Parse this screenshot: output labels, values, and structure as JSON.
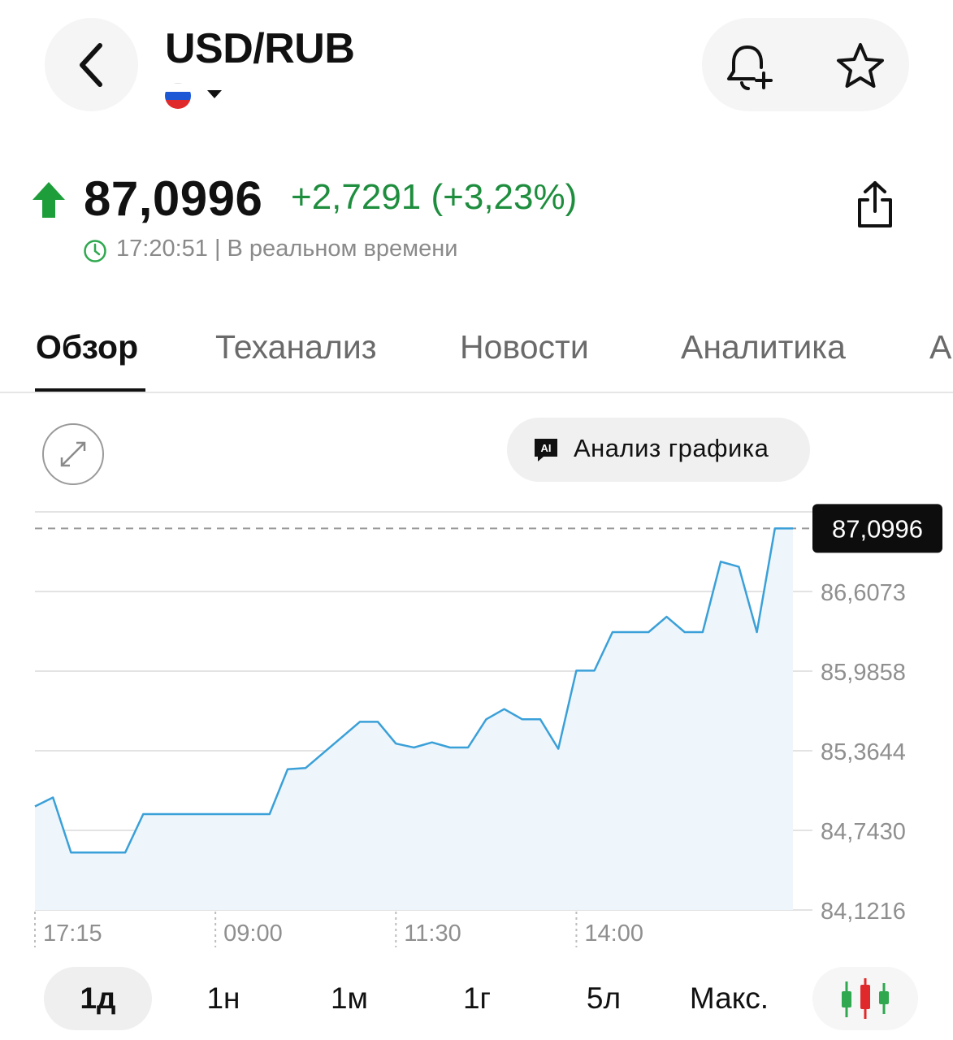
{
  "header": {
    "title": "USD/RUB",
    "flag_colors": [
      "#ffffff",
      "#1c57d6",
      "#e0292b"
    ]
  },
  "quote": {
    "price": "87,0996",
    "change": "+2,7291 (+3,23%)",
    "timestamp": "17:20:51 | В реальном времени",
    "up_color": "#1e8e3e"
  },
  "tabs": [
    {
      "label": "Обзор",
      "active": true
    },
    {
      "label": "Теханализ",
      "active": false
    },
    {
      "label": "Новости",
      "active": false
    },
    {
      "label": "Аналитика",
      "active": false
    },
    {
      "label": "А",
      "active": false
    }
  ],
  "chart_tools": {
    "ai_icon_text": "AI",
    "ai_button": "Анализ графика"
  },
  "chart_data": {
    "type": "area",
    "series": [
      {
        "values": [
          84.93,
          85.0,
          84.57,
          84.57,
          84.57,
          84.57,
          84.87,
          84.87,
          84.87,
          84.87,
          84.87,
          84.87,
          84.87,
          84.87,
          85.22,
          85.23,
          85.35,
          85.47,
          85.59,
          85.59,
          85.42,
          85.39,
          85.43,
          85.39,
          85.39,
          85.61,
          85.69,
          85.61,
          85.61,
          85.38,
          85.99,
          85.99,
          86.29,
          86.29,
          86.29,
          86.41,
          86.29,
          86.29,
          86.84,
          86.8,
          86.29,
          87.0996,
          87.0996
        ]
      }
    ],
    "color": "#3aa0d8",
    "fill": "#eef5fb",
    "x_ticks": [
      "17:15",
      "09:00",
      "11:30",
      "14:00"
    ],
    "y_ticks": [
      "86,6073",
      "85,9858",
      "85,3644",
      "84,7430",
      "84,1216"
    ],
    "ylim": [
      84.1216,
      87.2288
    ],
    "current_value": 87.0996,
    "current_label": "87,0996",
    "grid": true
  },
  "ranges": [
    {
      "label": "1д",
      "active": true
    },
    {
      "label": "1н",
      "active": false
    },
    {
      "label": "1м",
      "active": false
    },
    {
      "label": "1г",
      "active": false
    },
    {
      "label": "5л",
      "active": false
    },
    {
      "label": "Макс.",
      "active": false
    }
  ]
}
